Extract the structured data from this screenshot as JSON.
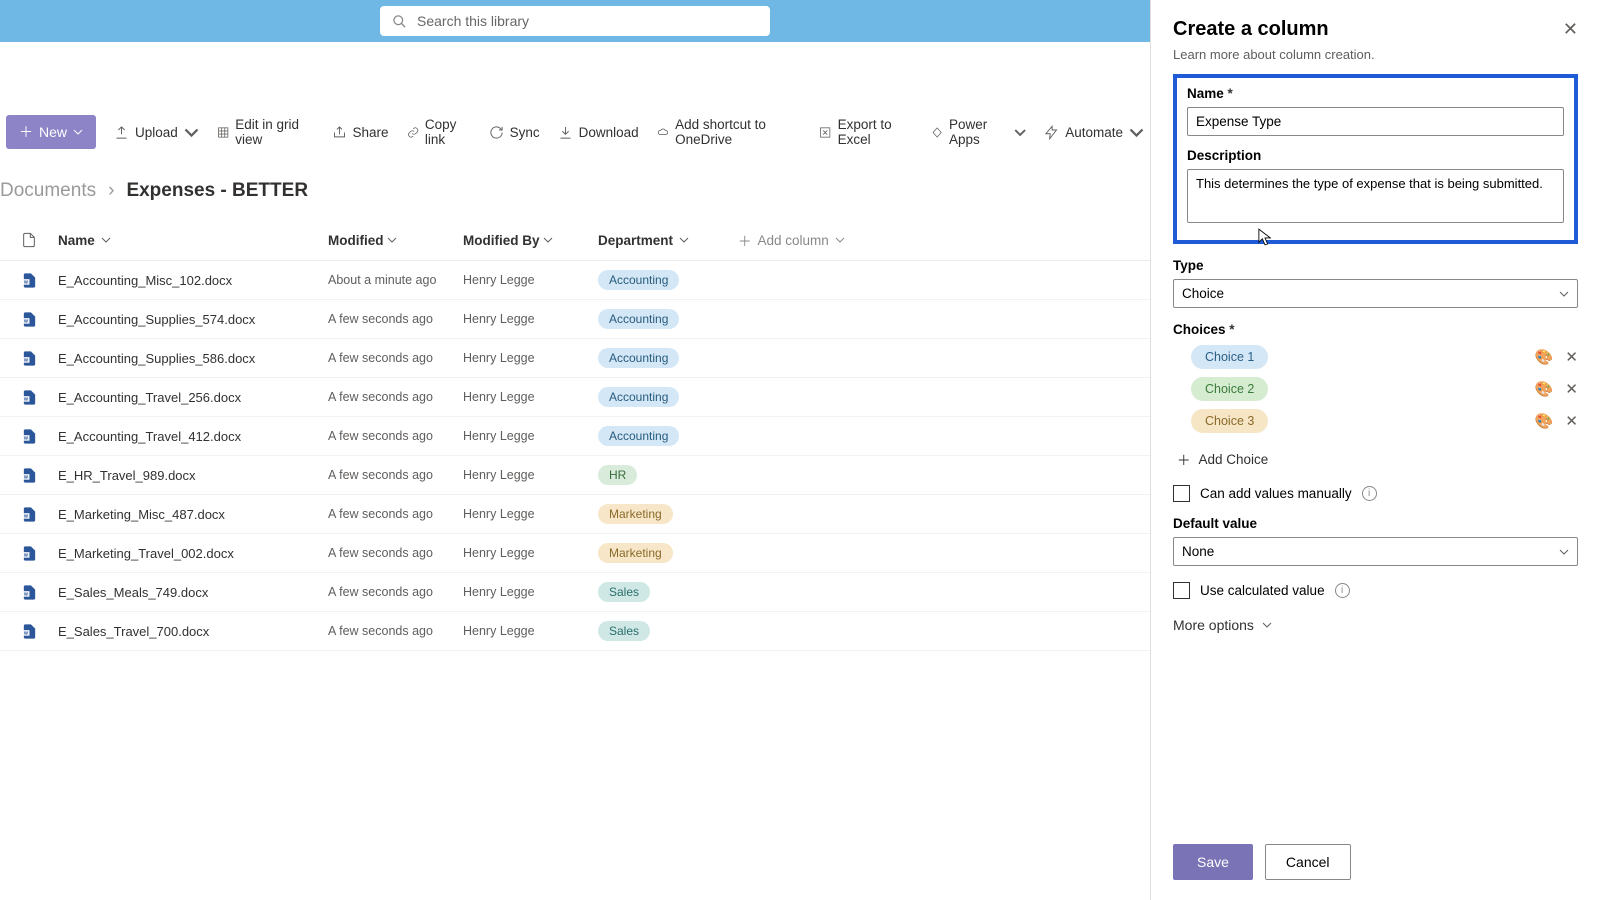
{
  "search": {
    "placeholder": "Search this library"
  },
  "toolbar": {
    "new": "New",
    "upload": "Upload",
    "edit": "Edit in grid view",
    "share": "Share",
    "copy": "Copy link",
    "sync": "Sync",
    "download": "Download",
    "shortcut": "Add shortcut to OneDrive",
    "excel": "Export to Excel",
    "powerapps": "Power Apps",
    "automate": "Automate"
  },
  "breadcrumb": {
    "root": "Documents",
    "current": "Expenses - BETTER"
  },
  "columns": {
    "name": "Name",
    "modified": "Modified",
    "modifiedBy": "Modified By",
    "department": "Department",
    "add": "Add column"
  },
  "rows": [
    {
      "name": "E_Accounting_Misc_102.docx",
      "modified": "About a minute ago",
      "by": "Henry Legge",
      "dept": "Accounting",
      "pill": "p-acc"
    },
    {
      "name": "E_Accounting_Supplies_574.docx",
      "modified": "A few seconds ago",
      "by": "Henry Legge",
      "dept": "Accounting",
      "pill": "p-acc"
    },
    {
      "name": "E_Accounting_Supplies_586.docx",
      "modified": "A few seconds ago",
      "by": "Henry Legge",
      "dept": "Accounting",
      "pill": "p-acc"
    },
    {
      "name": "E_Accounting_Travel_256.docx",
      "modified": "A few seconds ago",
      "by": "Henry Legge",
      "dept": "Accounting",
      "pill": "p-acc"
    },
    {
      "name": "E_Accounting_Travel_412.docx",
      "modified": "A few seconds ago",
      "by": "Henry Legge",
      "dept": "Accounting",
      "pill": "p-acc"
    },
    {
      "name": "E_HR_Travel_989.docx",
      "modified": "A few seconds ago",
      "by": "Henry Legge",
      "dept": "HR",
      "pill": "p-hr"
    },
    {
      "name": "E_Marketing_Misc_487.docx",
      "modified": "A few seconds ago",
      "by": "Henry Legge",
      "dept": "Marketing",
      "pill": "p-mkt"
    },
    {
      "name": "E_Marketing_Travel_002.docx",
      "modified": "A few seconds ago",
      "by": "Henry Legge",
      "dept": "Marketing",
      "pill": "p-mkt"
    },
    {
      "name": "E_Sales_Meals_749.docx",
      "modified": "A few seconds ago",
      "by": "Henry Legge",
      "dept": "Sales",
      "pill": "p-sal"
    },
    {
      "name": "E_Sales_Travel_700.docx",
      "modified": "A few seconds ago",
      "by": "Henry Legge",
      "dept": "Sales",
      "pill": "p-sal"
    }
  ],
  "panel": {
    "title": "Create a column",
    "learn": "Learn more about column creation.",
    "name_label": "Name",
    "name_value": "Expense Type",
    "desc_label": "Description",
    "desc_value": "This determines the type of expense that is being submitted.",
    "type_label": "Type",
    "type_value": "Choice",
    "choices_label": "Choices",
    "choices": [
      {
        "label": "Choice 1",
        "cls": "c1"
      },
      {
        "label": "Choice 2",
        "cls": "c2"
      },
      {
        "label": "Choice 3",
        "cls": "c3"
      }
    ],
    "add_choice": "Add Choice",
    "manual": "Can add values manually",
    "default_label": "Default value",
    "default_value": "None",
    "calculated": "Use calculated value",
    "more": "More options",
    "save": "Save",
    "cancel": "Cancel"
  }
}
